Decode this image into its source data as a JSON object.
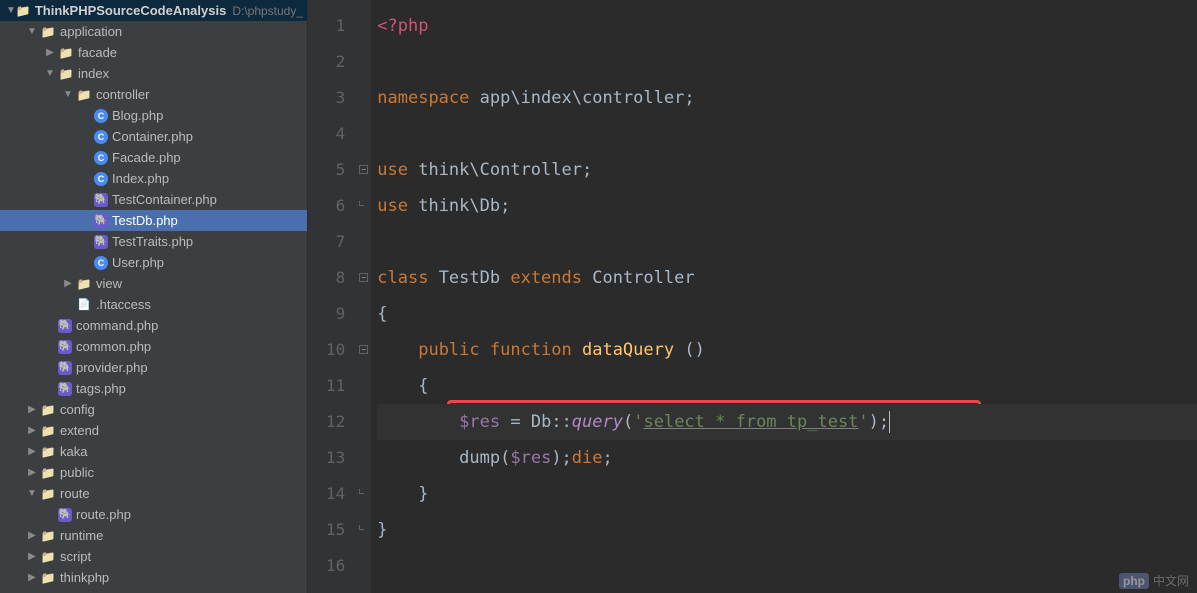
{
  "project": {
    "name": "ThinkPHPSourceCodeAnalysis",
    "path": "D:\\phpstudy_"
  },
  "tree": [
    {
      "indent": 0,
      "arrow": "down",
      "icon": "folder",
      "label": "ThinkPHPSourceCodeAnalysis",
      "path": "D:\\phpstudy_",
      "root": true
    },
    {
      "indent": 1,
      "arrow": "down",
      "icon": "folder",
      "label": "application"
    },
    {
      "indent": 2,
      "arrow": "right",
      "icon": "folder",
      "label": "facade"
    },
    {
      "indent": 2,
      "arrow": "down",
      "icon": "folder",
      "label": "index"
    },
    {
      "indent": 3,
      "arrow": "down",
      "icon": "folder",
      "label": "controller"
    },
    {
      "indent": 4,
      "arrow": "none",
      "icon": "php-class",
      "label": "Blog.php"
    },
    {
      "indent": 4,
      "arrow": "none",
      "icon": "php-class",
      "label": "Container.php"
    },
    {
      "indent": 4,
      "arrow": "none",
      "icon": "php-class",
      "label": "Facade.php"
    },
    {
      "indent": 4,
      "arrow": "none",
      "icon": "php-class",
      "label": "Index.php"
    },
    {
      "indent": 4,
      "arrow": "none",
      "icon": "php-file",
      "label": "TestContainer.php"
    },
    {
      "indent": 4,
      "arrow": "none",
      "icon": "php-file",
      "label": "TestDb.php",
      "selected": true
    },
    {
      "indent": 4,
      "arrow": "none",
      "icon": "php-file",
      "label": "TestTraits.php"
    },
    {
      "indent": 4,
      "arrow": "none",
      "icon": "php-class",
      "label": "User.php"
    },
    {
      "indent": 3,
      "arrow": "right",
      "icon": "folder",
      "label": "view"
    },
    {
      "indent": 3,
      "arrow": "none",
      "icon": "htaccess",
      "label": ".htaccess"
    },
    {
      "indent": 2,
      "arrow": "none",
      "icon": "php-file",
      "label": "command.php"
    },
    {
      "indent": 2,
      "arrow": "none",
      "icon": "php-file",
      "label": "common.php"
    },
    {
      "indent": 2,
      "arrow": "none",
      "icon": "php-file",
      "label": "provider.php"
    },
    {
      "indent": 2,
      "arrow": "none",
      "icon": "php-file",
      "label": "tags.php"
    },
    {
      "indent": 1,
      "arrow": "right",
      "icon": "folder",
      "label": "config"
    },
    {
      "indent": 1,
      "arrow": "right",
      "icon": "folder",
      "label": "extend"
    },
    {
      "indent": 1,
      "arrow": "right",
      "icon": "folder",
      "label": "kaka"
    },
    {
      "indent": 1,
      "arrow": "right",
      "icon": "folder",
      "label": "public"
    },
    {
      "indent": 1,
      "arrow": "down",
      "icon": "folder",
      "label": "route"
    },
    {
      "indent": 2,
      "arrow": "none",
      "icon": "php-file",
      "label": "route.php"
    },
    {
      "indent": 1,
      "arrow": "right",
      "icon": "folder",
      "label": "runtime"
    },
    {
      "indent": 1,
      "arrow": "right",
      "icon": "folder",
      "label": "script"
    },
    {
      "indent": 1,
      "arrow": "right",
      "icon": "folder",
      "label": "thinkphp"
    }
  ],
  "code": {
    "lines": [
      {
        "n": 1,
        "tokens": [
          {
            "t": "t-php-open",
            "v": "<?php"
          }
        ]
      },
      {
        "n": 2,
        "tokens": []
      },
      {
        "n": 3,
        "tokens": [
          {
            "t": "t-keyword",
            "v": "namespace "
          },
          {
            "t": "t-ns",
            "v": "app\\index\\controller"
          },
          {
            "t": "t-punc",
            "v": ";"
          }
        ]
      },
      {
        "n": 4,
        "tokens": []
      },
      {
        "n": 5,
        "tokens": [
          {
            "t": "t-keyword",
            "v": "use "
          },
          {
            "t": "t-ns",
            "v": "think\\Controller"
          },
          {
            "t": "t-punc",
            "v": ";"
          }
        ],
        "fold": "minus"
      },
      {
        "n": 6,
        "tokens": [
          {
            "t": "t-keyword",
            "v": "use "
          },
          {
            "t": "t-ns",
            "v": "think\\Db"
          },
          {
            "t": "t-punc",
            "v": ";"
          }
        ],
        "fold": "end"
      },
      {
        "n": 7,
        "tokens": []
      },
      {
        "n": 8,
        "tokens": [
          {
            "t": "t-keyword",
            "v": "class "
          },
          {
            "t": "t-class",
            "v": "TestDb "
          },
          {
            "t": "t-keyword",
            "v": "extends "
          },
          {
            "t": "t-class",
            "v": "Controller"
          }
        ],
        "fold": "minus"
      },
      {
        "n": 9,
        "tokens": [
          {
            "t": "t-punc",
            "v": "{"
          }
        ]
      },
      {
        "n": 10,
        "tokens": [
          {
            "t": "",
            "v": "    "
          },
          {
            "t": "t-keyword",
            "v": "public function "
          },
          {
            "t": "t-func",
            "v": "dataQuery "
          },
          {
            "t": "t-punc",
            "v": "()"
          }
        ],
        "fold": "minus"
      },
      {
        "n": 11,
        "tokens": [
          {
            "t": "",
            "v": "    "
          },
          {
            "t": "t-punc",
            "v": "{"
          }
        ]
      },
      {
        "n": 12,
        "tokens": [
          {
            "t": "",
            "v": "        "
          },
          {
            "t": "t-var",
            "v": "$res"
          },
          {
            "t": "t-punc",
            "v": " = "
          },
          {
            "t": "t-class",
            "v": "Db"
          },
          {
            "t": "t-punc",
            "v": "::"
          },
          {
            "t": "t-static",
            "v": "query"
          },
          {
            "t": "t-punc",
            "v": "("
          },
          {
            "t": "t-string",
            "v": "'"
          },
          {
            "t": "t-string-sql",
            "v": "select * from tp_test"
          },
          {
            "t": "t-string",
            "v": "'"
          },
          {
            "t": "t-punc",
            "v": ");"
          }
        ],
        "highlight": true,
        "cursor": true
      },
      {
        "n": 13,
        "tokens": [
          {
            "t": "",
            "v": "        "
          },
          {
            "t": "t-ns",
            "v": "dump"
          },
          {
            "t": "t-punc",
            "v": "("
          },
          {
            "t": "t-var",
            "v": "$res"
          },
          {
            "t": "t-punc",
            "v": ");"
          },
          {
            "t": "t-keyword",
            "v": "die"
          },
          {
            "t": "t-punc",
            "v": ";"
          }
        ]
      },
      {
        "n": 14,
        "tokens": [
          {
            "t": "",
            "v": "    "
          },
          {
            "t": "t-punc",
            "v": "}"
          }
        ],
        "fold": "end"
      },
      {
        "n": 15,
        "tokens": [
          {
            "t": "t-punc",
            "v": "}"
          }
        ],
        "fold": "end"
      },
      {
        "n": 16,
        "tokens": []
      }
    ]
  },
  "watermark": {
    "badge": "php",
    "text": "中文网"
  }
}
